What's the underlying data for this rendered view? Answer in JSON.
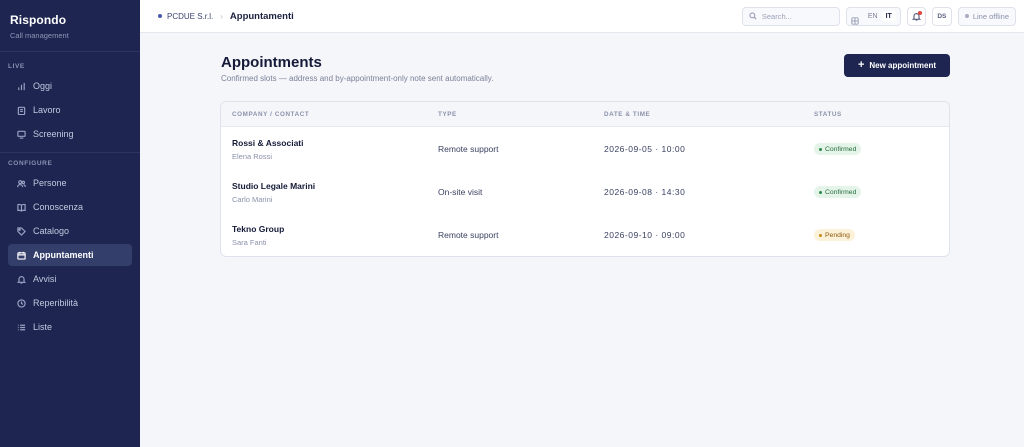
{
  "app": {
    "name": "Rispondo",
    "subtitle": "Call management"
  },
  "sidebar": {
    "sections": [
      {
        "label": "LIVE",
        "items": [
          {
            "label": "Oggi",
            "icon": "bar-chart-icon"
          },
          {
            "label": "Lavoro",
            "icon": "clipboard-icon"
          },
          {
            "label": "Screening",
            "icon": "monitor-icon"
          }
        ]
      },
      {
        "label": "CONFIGURE",
        "items": [
          {
            "label": "Persone",
            "icon": "users-icon"
          },
          {
            "label": "Conoscenza",
            "icon": "book-icon"
          },
          {
            "label": "Catalogo",
            "icon": "tag-icon"
          },
          {
            "label": "Appuntamenti",
            "icon": "calendar-icon",
            "active": true
          },
          {
            "label": "Avvisi",
            "icon": "bell-icon"
          },
          {
            "label": "Reperibilità",
            "icon": "clock-icon"
          },
          {
            "label": "Liste",
            "icon": "list-icon"
          }
        ]
      }
    ]
  },
  "topbar": {
    "org": "PCDUE S.r.l.",
    "separator": "›",
    "page": "Appuntamenti",
    "search_placeholder": "Search...",
    "languages": [
      "EN",
      "IT"
    ],
    "selected_language": "IT",
    "avatar_initials": "DS",
    "line_status": "Line offline"
  },
  "main": {
    "title": "Appointments",
    "subtitle": "Confirmed slots — address and by-appointment-only note sent automatically.",
    "new_button_label": "New appointment",
    "new_button_icon": "+",
    "table": {
      "headers": [
        "COMPANY / CONTACT",
        "TYPE",
        "DATE & TIME",
        "STATUS"
      ],
      "rows": [
        {
          "company": "Rossi & Associati",
          "contact": "Elena Rossi",
          "type": "Remote support",
          "datetime": "2026-09-05 · 10:00",
          "status": "Confirmed"
        },
        {
          "company": "Studio Legale Marini",
          "contact": "Carlo Marini",
          "type": "On-site visit",
          "datetime": "2026-09-08 · 14:30",
          "status": "Confirmed"
        },
        {
          "company": "Tekno Group",
          "contact": "Sara Fanti",
          "type": "Remote support",
          "datetime": "2026-09-10 · 09:00",
          "status": "Pending"
        }
      ]
    }
  },
  "colors": {
    "sidebar_bg": "#1d2550",
    "primary": "#1d2550",
    "confirmed": "#2f8a4a",
    "pending": "#c98a16"
  }
}
